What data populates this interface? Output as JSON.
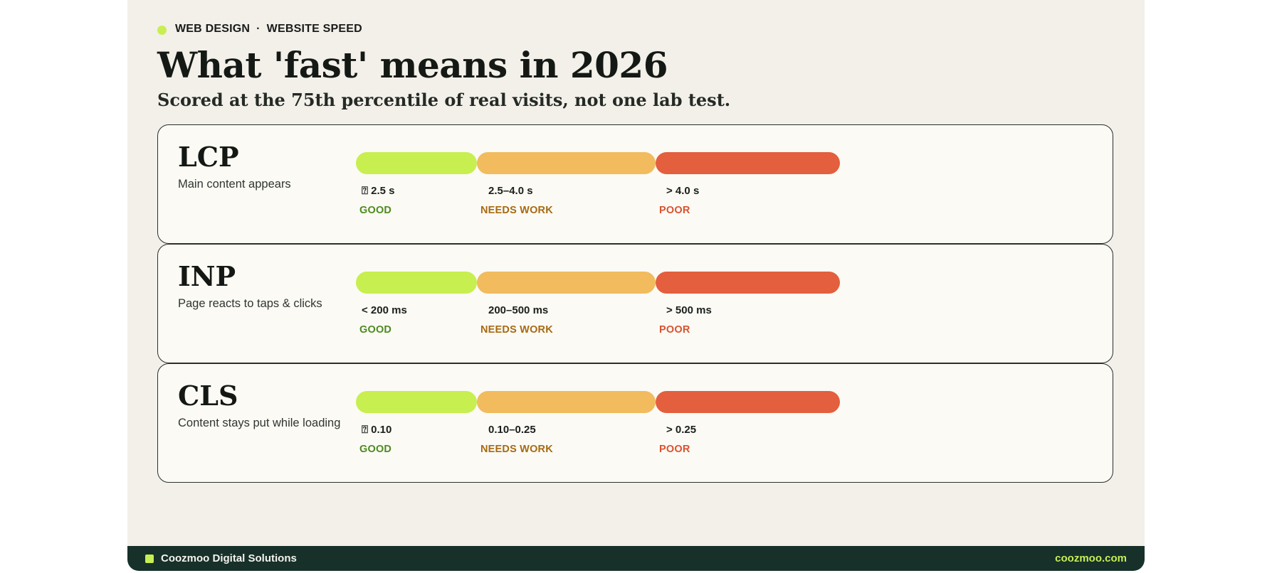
{
  "header": {
    "category": "WEB DESIGN",
    "separator": "·",
    "topic": "WEBSITE SPEED",
    "title": "What 'fast' means in 2026",
    "subtitle": "Scored at the 75th percentile of real visits, not one lab test."
  },
  "colors": {
    "good": "#c7ef4f",
    "needs_work": "#f1bb5e",
    "poor": "#e35f3d",
    "footer_bg": "#17302a",
    "accent": "#c8ef52"
  },
  "metrics": [
    {
      "name": "LCP",
      "description": "Main content appears",
      "good_range": "⍰ 2.5 s",
      "mid_range": "2.5–4.0 s",
      "poor_range": "> 4.0 s",
      "good_label": "GOOD",
      "mid_label": "NEEDS WORK",
      "poor_label": "POOR"
    },
    {
      "name": "INP",
      "description": "Page reacts to taps & clicks",
      "good_range": "< 200 ms",
      "mid_range": "200–500 ms",
      "poor_range": "> 500 ms",
      "good_label": "GOOD",
      "mid_label": "NEEDS WORK",
      "poor_label": "POOR"
    },
    {
      "name": "CLS",
      "description": "Content stays put while loading",
      "good_range": "⍰ 0.10",
      "mid_range": "0.10–0.25",
      "poor_range": "> 0.25",
      "good_label": "GOOD",
      "mid_label": "NEEDS WORK",
      "poor_label": "POOR"
    }
  ],
  "footer": {
    "company": "Coozmoo Digital Solutions",
    "website": "coozmoo.com"
  }
}
